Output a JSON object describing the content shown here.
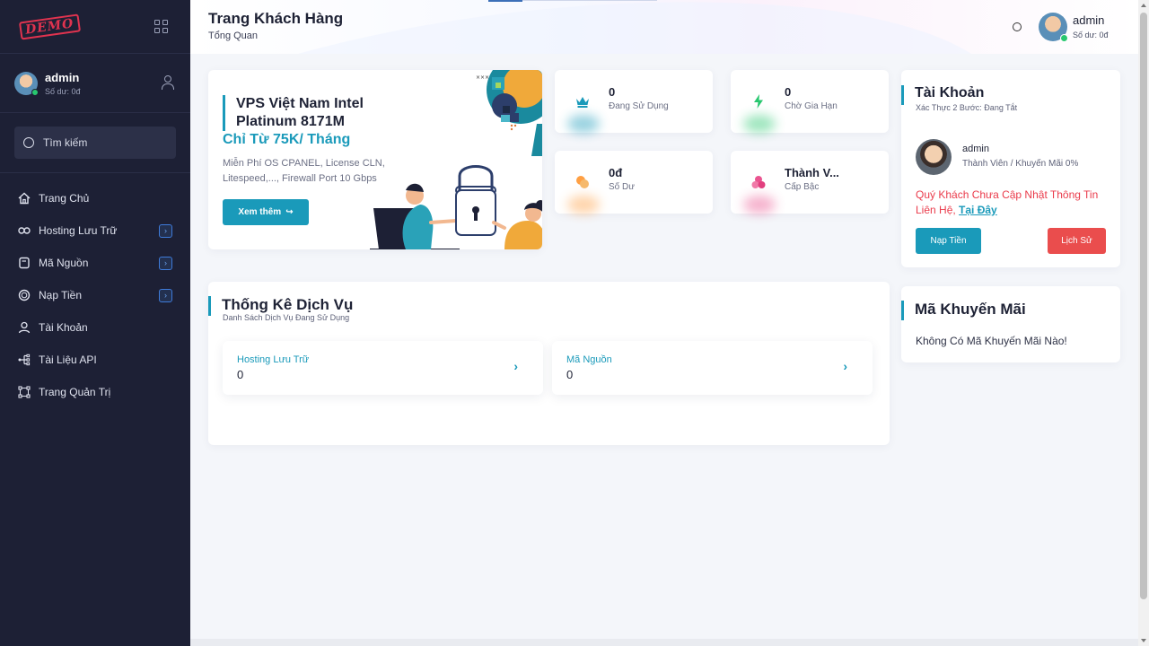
{
  "brand": {
    "logo_text": "DEMO"
  },
  "sidebar": {
    "user": {
      "name": "admin",
      "balance": "Số dư: 0đ"
    },
    "search_label": "Tìm kiếm",
    "items": [
      {
        "label": "Trang Chủ",
        "icon": "home-icon",
        "has_arrow": false
      },
      {
        "label": "Hosting Lưu Trữ",
        "icon": "infinity-icon",
        "has_arrow": true
      },
      {
        "label": "Mã Nguồn",
        "icon": "file-icon",
        "has_arrow": true
      },
      {
        "label": "Nạp Tiền",
        "icon": "coin-icon",
        "has_arrow": true
      },
      {
        "label": "Tài Khoản",
        "icon": "user-icon",
        "has_arrow": false
      },
      {
        "label": "Tài Liệu API",
        "icon": "api-icon",
        "has_arrow": false
      },
      {
        "label": "Trang Quản Trị",
        "icon": "admin-icon",
        "has_arrow": false
      }
    ]
  },
  "header": {
    "title": "Trang Khách Hàng",
    "subtitle": "Tổng Quan",
    "user_name": "admin",
    "user_balance": "Số dư: 0đ"
  },
  "promo": {
    "title": "VPS Việt Nam Intel Platinum 8171M",
    "price": "Chỉ Từ 75K/ Tháng",
    "description": "Miễn Phí OS CPANEL, License CLN, Litespeed,..., Firewall Port 10 Gbps",
    "button": "Xem thêm"
  },
  "stats": [
    {
      "value": "0",
      "label": "Đang Sử Dụng",
      "icon": "crown-icon",
      "color": "#1a9aba"
    },
    {
      "value": "0",
      "label": "Chờ Gia Hạn",
      "icon": "bolt-icon",
      "color": "#28c76f"
    },
    {
      "value": "0đ",
      "label": "Số Dư",
      "icon": "coins-icon",
      "color": "#ff9f43"
    },
    {
      "value": "Thành V...",
      "label": "Cấp Bậc",
      "icon": "rank-icon",
      "color": "#ea5490"
    }
  ],
  "account": {
    "title": "Tài Khoản",
    "two_factor": "Xác Thực 2 Bước: Đang Tắt",
    "name": "admin",
    "membership": "Thành Viên / Khuyến Mãi 0%",
    "warning": "Quý Khách Chưa Cập Nhật Thông Tin Liên Hệ,",
    "warning_link": "Tại Đây",
    "deposit_button": "Nạp Tiền",
    "history_button": "Lịch Sử"
  },
  "promo_code": {
    "title": "Mã Khuyến Mãi",
    "text": "Không Có Mã Khuyến Mãi Nào!"
  },
  "service_stats": {
    "title": "Thống Kê Dịch Vụ",
    "subtitle": "Danh Sách Dịch Vụ Đang Sử Dụng",
    "items": [
      {
        "name": "Hosting Lưu Trữ",
        "count": "0"
      },
      {
        "name": "Mã Nguồn",
        "count": "0"
      }
    ]
  },
  "colors": {
    "accent": "#1a9aba",
    "sidebar_bg": "#1d2035",
    "danger": "#ea4d4d"
  }
}
